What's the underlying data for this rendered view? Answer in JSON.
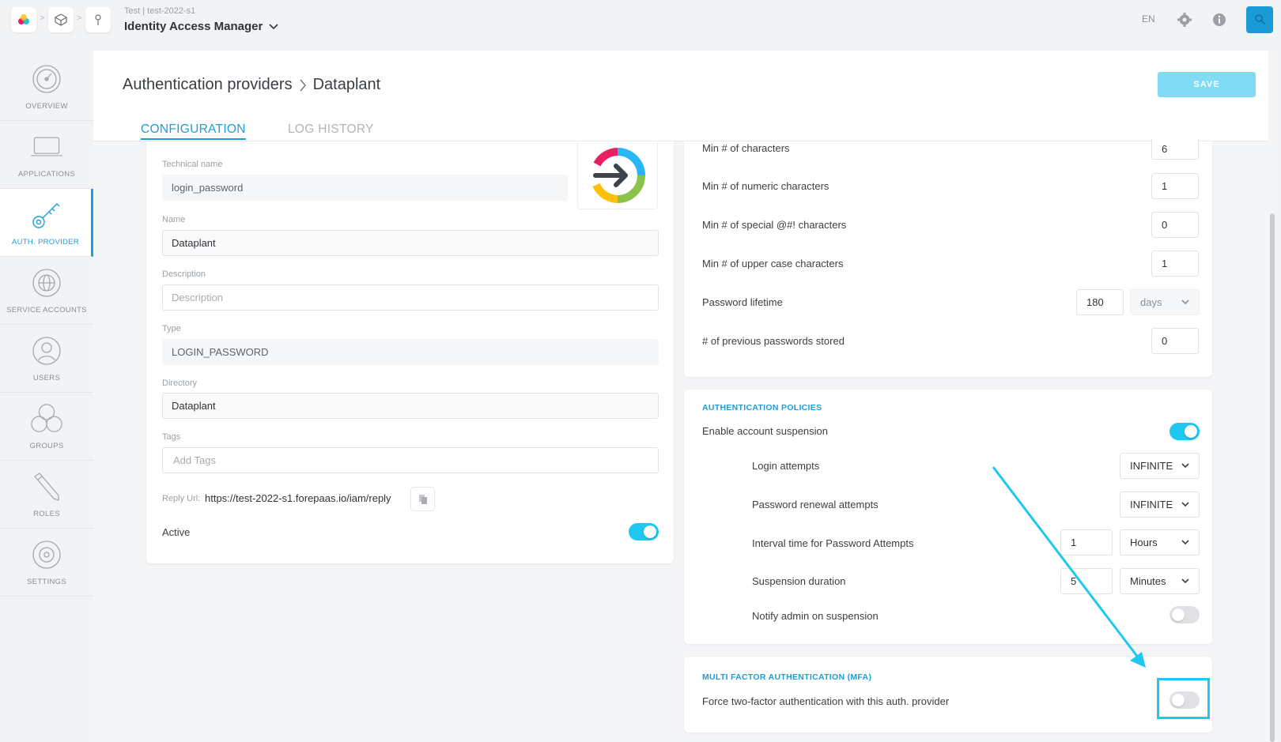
{
  "topbar": {
    "app_subtitle": "Test | test-2022-s1",
    "app_title": "Identity Access Manager",
    "language": "EN",
    "icons": [
      "forepaas-logo-icon",
      "cube-icon",
      "pin-icon",
      "gear-icon",
      "info-icon",
      "user-avatar-icon"
    ]
  },
  "sidebar": {
    "items": [
      {
        "label": "OVERVIEW",
        "icon": "gauge-icon"
      },
      {
        "label": "APPLICATIONS",
        "icon": "laptop-icon"
      },
      {
        "label": "AUTH. PROVIDER",
        "icon": "key-icon",
        "active": true
      },
      {
        "label": "SERVICE ACCOUNTS",
        "icon": "globe-icon"
      },
      {
        "label": "USERS",
        "icon": "user-icon"
      },
      {
        "label": "GROUPS",
        "icon": "group-icon"
      },
      {
        "label": "ROLES",
        "icon": "pencil-icon"
      },
      {
        "label": "SETTINGS",
        "icon": "settings-icon"
      }
    ]
  },
  "header": {
    "breadcrumb_parent": "Authentication providers",
    "breadcrumb_current": "Dataplant",
    "save_label": "SAVE",
    "tabs": [
      {
        "label": "CONFIGURATION",
        "active": true
      },
      {
        "label": "LOG HISTORY",
        "active": false
      }
    ]
  },
  "form": {
    "technical_name_label": "Technical name",
    "technical_name_value": "login_password",
    "name_label": "Name",
    "name_value": "Dataplant",
    "description_label": "Description",
    "description_placeholder": "Description",
    "type_label": "Type",
    "type_value": "LOGIN_PASSWORD",
    "directory_label": "Directory",
    "directory_value": "Dataplant",
    "tags_label": "Tags",
    "tags_placeholder": "Add Tags",
    "reply_url_label": "Reply Url:",
    "reply_url_value": "https://test-2022-s1.forepaas.io/iam/reply",
    "active_label": "Active",
    "active": true
  },
  "password_policy": {
    "rows": [
      {
        "label": "Min # of characters",
        "value": "6"
      },
      {
        "label": "Min # of numeric characters",
        "value": "1"
      },
      {
        "label": "Min # of special @#! characters",
        "value": "0"
      },
      {
        "label": "Min # of upper case characters",
        "value": "1"
      }
    ],
    "lifetime_label": "Password lifetime",
    "lifetime_value": "180",
    "lifetime_unit": "days",
    "previous_label": "# of previous passwords stored",
    "previous_value": "0"
  },
  "auth_policies": {
    "title": "AUTHENTICATION POLICIES",
    "enable_suspension_label": "Enable account suspension",
    "enable_suspension": true,
    "login_attempts_label": "Login attempts",
    "login_attempts_value": "INFINITE",
    "renewal_attempts_label": "Password renewal attempts",
    "renewal_attempts_value": "INFINITE",
    "interval_label": "Interval time for Password Attempts",
    "interval_value": "1",
    "interval_unit": "Hours",
    "suspension_label": "Suspension duration",
    "suspension_value": "5",
    "suspension_unit": "Minutes",
    "notify_label": "Notify admin on suspension",
    "notify": false
  },
  "mfa": {
    "title": "MULTI FACTOR AUTHENTICATION (MFA)",
    "force_label": "Force two-factor authentication with this auth. provider",
    "force": false
  },
  "colors": {
    "accent": "#1e9ed6",
    "toggle_on": "#1ec8f0",
    "annotation": "#1ec8f0"
  }
}
